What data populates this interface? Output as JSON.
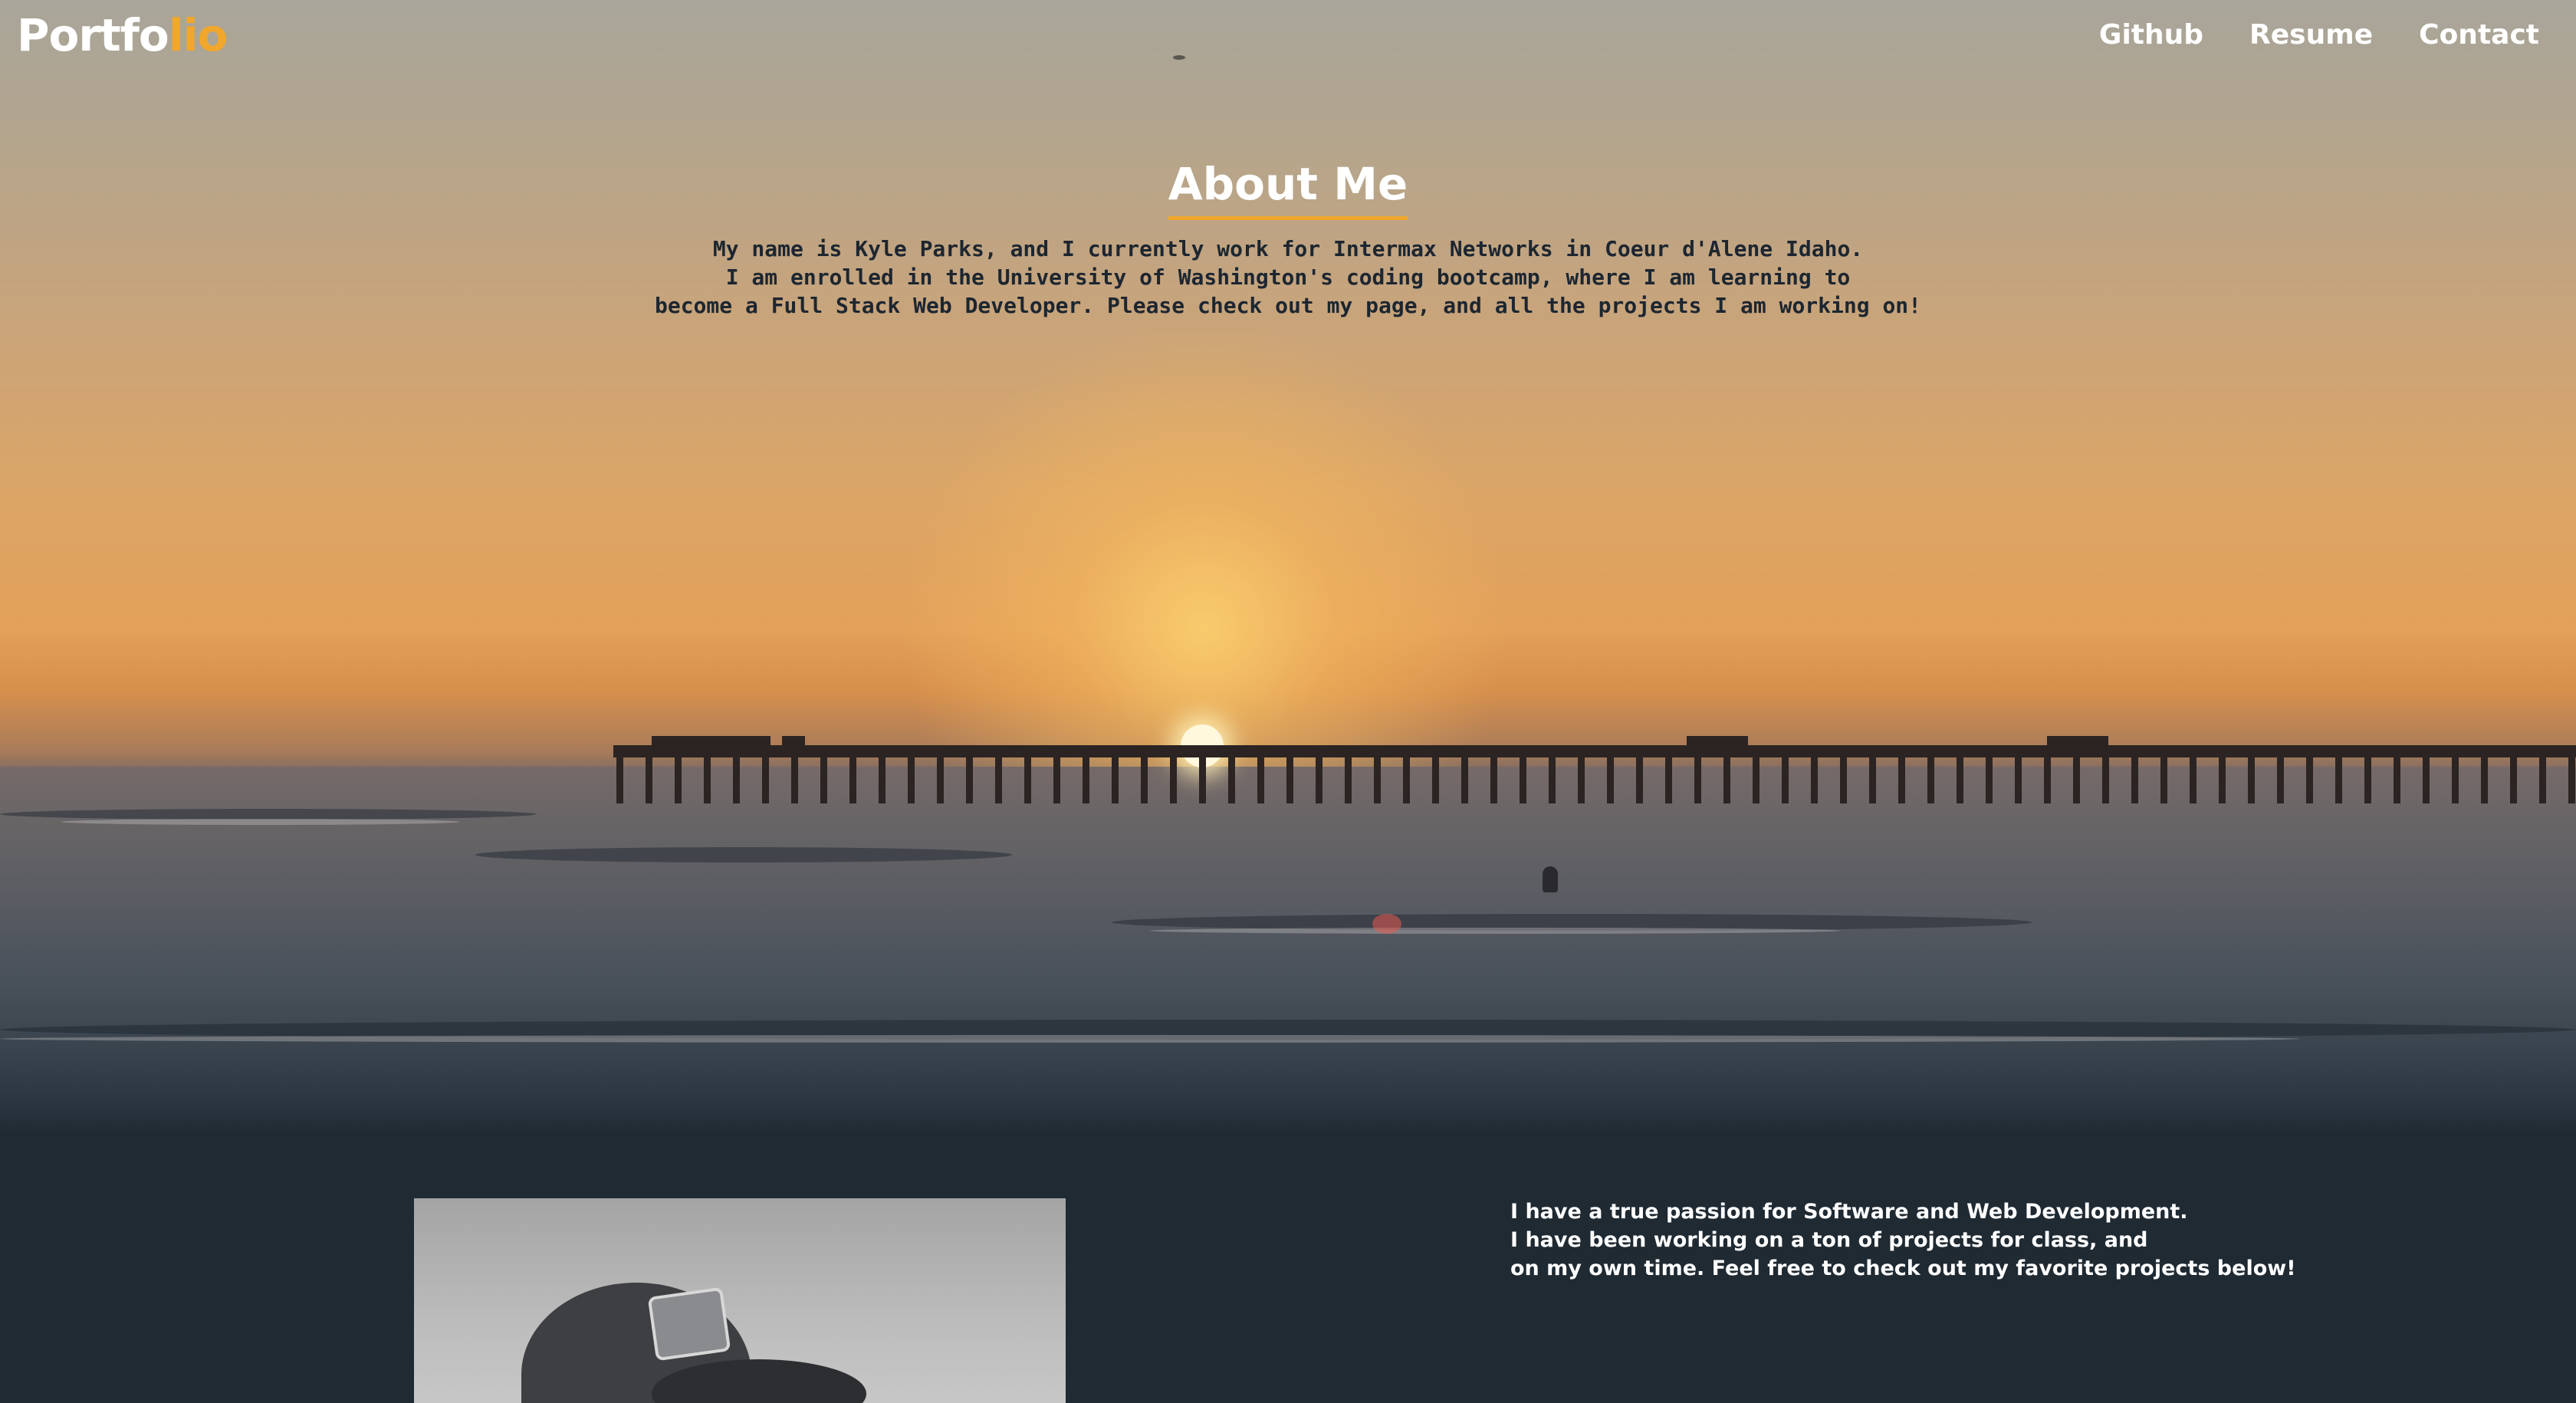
{
  "navbar": {
    "brand_main": "Portfo",
    "brand_accent": "lio",
    "links": [
      {
        "label": "Github"
      },
      {
        "label": "Resume"
      },
      {
        "label": "Contact"
      }
    ]
  },
  "about": {
    "title": "About Me",
    "lines": [
      "My name is Kyle Parks, and I currently work for Intermax Networks in Coeur d'Alene Idaho.",
      "I am enrolled in the University of Washington's coding bootcamp, where I am learning to",
      "become a Full Stack Web Developer. Please check out my page, and all the projects I am working on!"
    ]
  },
  "passion": {
    "lines": [
      "I have a true passion for Software and Web Development.",
      "I have been working on a ton of projects for class, and",
      "on my own time. Feel free to check out my favorite projects below!"
    ]
  },
  "colors": {
    "accent": "#f0a72c",
    "background": "#1f2a33",
    "text_light": "#ffffff",
    "text_dark": "#1d2630"
  }
}
